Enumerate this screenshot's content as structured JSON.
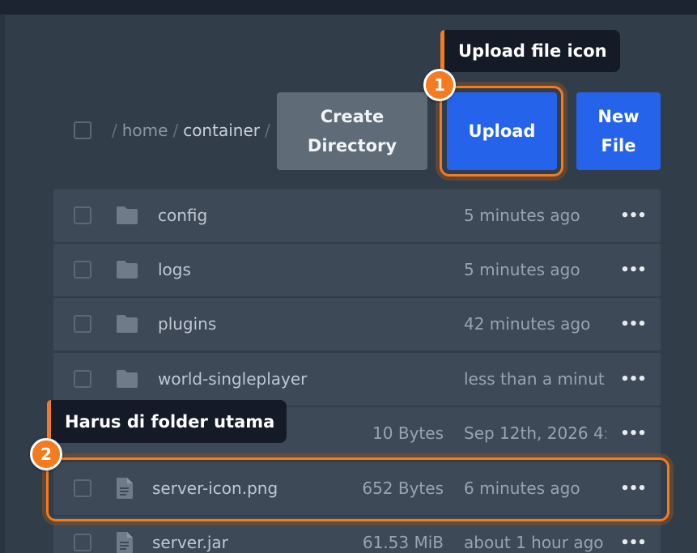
{
  "breadcrumb": {
    "segments": [
      "home",
      "container"
    ],
    "separator": "/"
  },
  "actions": {
    "create_directory": "Create\nDirectory",
    "upload": "Upload",
    "new_file": "New\nFile"
  },
  "annotations": {
    "badge_1": "1",
    "tooltip_1": "Upload file icon",
    "badge_2": "2",
    "tooltip_2": "Harus di folder utama",
    "accent_color": "#f47b20"
  },
  "files": [
    {
      "type": "folder",
      "icon": "folder-icon",
      "name": "config",
      "size": "",
      "modified": "5 minutes ago"
    },
    {
      "type": "folder",
      "icon": "folder-icon",
      "name": "logs",
      "size": "",
      "modified": "5 minutes ago"
    },
    {
      "type": "folder",
      "icon": "folder-icon",
      "name": "plugins",
      "size": "",
      "modified": "42 minutes ago"
    },
    {
      "type": "folder",
      "icon": "folder-icon",
      "name": "world-singleplayer",
      "size": "",
      "modified": "less than a minut"
    },
    {
      "type": "file",
      "icon": "file-icon",
      "name": "",
      "size": "10 Bytes",
      "modified": "Sep 12th, 2026 4:"
    },
    {
      "type": "file",
      "icon": "file-icon",
      "name": "server-icon.png",
      "size": "652 Bytes",
      "modified": "6 minutes ago"
    },
    {
      "type": "file",
      "icon": "file-icon",
      "name": "server.jar",
      "size": "61.53 MiB",
      "modified": "about 1 hour ago"
    }
  ],
  "colors": {
    "primary_button": "#2563eb",
    "secondary_button": "#5f6b77",
    "row_background": "#3d4956",
    "page_background": "#323d4a"
  }
}
